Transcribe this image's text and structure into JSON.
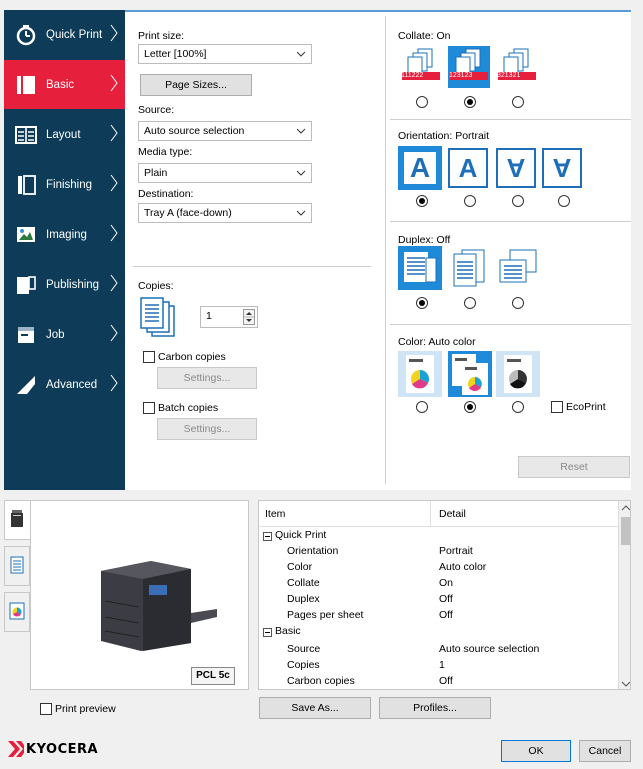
{
  "sidebar": {
    "items": [
      {
        "label": "Quick Print",
        "icon": "stopwatch-icon"
      },
      {
        "label": "Basic",
        "icon": "basic-icon"
      },
      {
        "label": "Layout",
        "icon": "layout-icon"
      },
      {
        "label": "Finishing",
        "icon": "finishing-icon"
      },
      {
        "label": "Imaging",
        "icon": "imaging-icon"
      },
      {
        "label": "Publishing",
        "icon": "publishing-icon"
      },
      {
        "label": "Job",
        "icon": "job-icon"
      },
      {
        "label": "Advanced",
        "icon": "advanced-icon"
      }
    ],
    "active": "Basic"
  },
  "basic": {
    "print_size_label": "Print size:",
    "print_size_value": "Letter [100%]",
    "page_sizes_button": "Page Sizes...",
    "source_label": "Source:",
    "source_value": "Auto source selection",
    "media_type_label": "Media type:",
    "media_type_value": "Plain",
    "destination_label": "Destination:",
    "destination_value": "Tray A (face-down)",
    "copies_label": "Copies:",
    "copies_value": "1",
    "carbon_copies_label": "Carbon copies",
    "carbon_settings_button": "Settings...",
    "batch_copies_label": "Batch copies",
    "batch_settings_button": "Settings..."
  },
  "right": {
    "collate_label": "Collate:  On",
    "collate_tiles": [
      "111222",
      "123123",
      "321321"
    ],
    "orientation_label": "Orientation:  Portrait",
    "orientation_glyph": "A",
    "duplex_label": "Duplex:  Off",
    "color_label": "Color:  Auto color",
    "ecoprint_label": "EcoPrint",
    "reset_button": "Reset"
  },
  "preview": {
    "badge": "PCL 5c",
    "print_preview_label": "Print preview"
  },
  "table": {
    "headers": [
      "Item",
      "Detail"
    ],
    "rows": [
      {
        "group": true,
        "item": "Quick Print",
        "detail": ""
      },
      {
        "group": false,
        "item": "Orientation",
        "detail": "Portrait"
      },
      {
        "group": false,
        "item": "Color",
        "detail": "Auto color"
      },
      {
        "group": false,
        "item": "Collate",
        "detail": "On"
      },
      {
        "group": false,
        "item": "Duplex",
        "detail": "Off"
      },
      {
        "group": false,
        "item": "Pages per sheet",
        "detail": "Off"
      },
      {
        "group": true,
        "item": "Basic",
        "detail": ""
      },
      {
        "group": false,
        "item": "Source",
        "detail": "Auto source selection"
      },
      {
        "group": false,
        "item": "Copies",
        "detail": "1"
      },
      {
        "group": false,
        "item": "Carbon copies",
        "detail": "Off"
      }
    ]
  },
  "buttons": {
    "save_as": "Save As...",
    "profiles": "Profiles...",
    "ok": "OK",
    "cancel": "Cancel"
  },
  "brand": {
    "name": "KYOCERA",
    "color": "#e51f3c"
  },
  "colors": {
    "sidebar_bg": "#0d3b58",
    "active_bg": "#e51f3c",
    "accent_blue": "#1e8ad8"
  }
}
